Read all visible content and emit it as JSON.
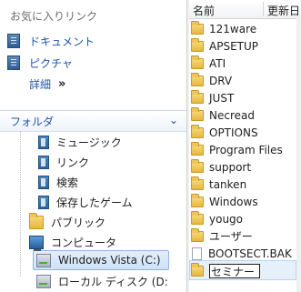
{
  "favorites": {
    "header": "お気に入りリンク",
    "items": [
      {
        "label": "ドキュメント",
        "icon": "document-icon"
      },
      {
        "label": "ピクチャ",
        "icon": "picture-icon"
      }
    ],
    "more_label": "詳細",
    "more_chevron": "»"
  },
  "folders_bar": {
    "label": "フォルダ",
    "arrow": "⌄"
  },
  "tree": [
    {
      "label": "ミュージック",
      "icon": "music-library-icon"
    },
    {
      "label": "リンク",
      "icon": "links-icon"
    },
    {
      "label": "検索",
      "icon": "search-library-icon"
    },
    {
      "label": "保存したゲーム",
      "icon": "saved-games-icon"
    },
    {
      "label": "パブリック",
      "icon": "folder-icon"
    },
    {
      "label": "コンピュータ",
      "icon": "computer-icon"
    },
    {
      "label": "Windows Vista (C:)",
      "icon": "drive-icon"
    },
    {
      "label": "ローカル ディスク (D:",
      "icon": "drive-icon"
    }
  ],
  "file_list": {
    "columns": [
      "名前",
      "更新日"
    ],
    "items": [
      {
        "name": "121ware",
        "type": "folder"
      },
      {
        "name": "APSETUP",
        "type": "folder"
      },
      {
        "name": "ATI",
        "type": "folder"
      },
      {
        "name": "DRV",
        "type": "folder"
      },
      {
        "name": "JUST",
        "type": "folder"
      },
      {
        "name": "Necread",
        "type": "folder"
      },
      {
        "name": "OPTIONS",
        "type": "folder"
      },
      {
        "name": "Program Files",
        "type": "folder"
      },
      {
        "name": "support",
        "type": "folder"
      },
      {
        "name": "tanken",
        "type": "folder"
      },
      {
        "name": "Windows",
        "type": "folder"
      },
      {
        "name": "yougo",
        "type": "folder"
      },
      {
        "name": "ユーザー",
        "type": "folder"
      },
      {
        "name": "BOOTSECT.BAK",
        "type": "file"
      }
    ],
    "rename_value": "セミナー"
  }
}
